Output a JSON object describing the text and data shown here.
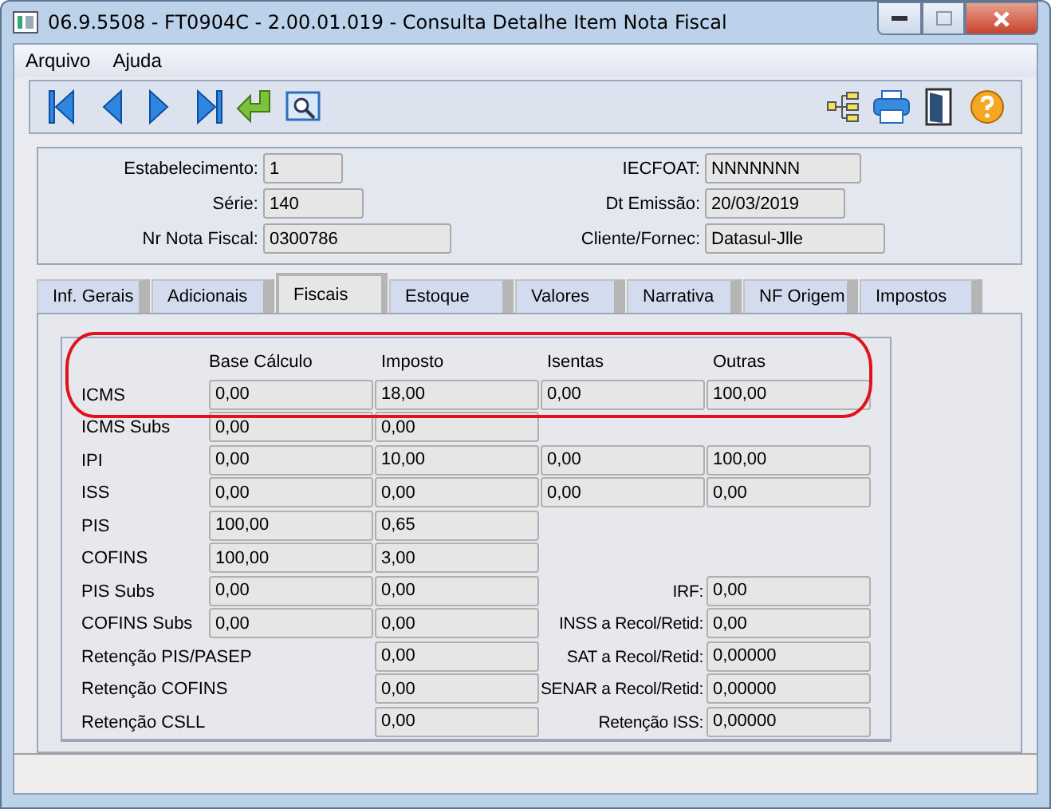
{
  "window": {
    "title": "06.9.5508 - FT0904C - 2.00.01.019 - Consulta Detalhe Item Nota Fiscal"
  },
  "menu": [
    "Arquivo",
    "Ajuda"
  ],
  "header": {
    "left": [
      {
        "label": "Estabelecimento:",
        "value": "1"
      },
      {
        "label": "Série:",
        "value": "140"
      },
      {
        "label": "Nr Nota Fiscal:",
        "value": "0300786"
      }
    ],
    "right": [
      {
        "label": "IECFOAT:",
        "value": "NNNNNNN"
      },
      {
        "label": "Dt Emissão:",
        "value": "20/03/2019"
      },
      {
        "label": "Cliente/Fornec:",
        "value": "Datasul-Jlle"
      }
    ]
  },
  "tabs": [
    {
      "label": "Inf. Gerais",
      "selected": false
    },
    {
      "label": "Adicionais",
      "selected": false
    },
    {
      "label": "Fiscais",
      "selected": true
    },
    {
      "label": "Estoque",
      "selected": false
    },
    {
      "label": "Valores",
      "selected": false
    },
    {
      "label": "Narrativa",
      "selected": false
    },
    {
      "label": "NF Origem",
      "selected": false
    },
    {
      "label": "Impostos",
      "selected": false
    }
  ],
  "fiscais": {
    "columns": [
      "Base Cálculo",
      "Imposto",
      "Isentas",
      "Outras"
    ],
    "highlight_first_row": true,
    "rows": [
      {
        "label": "ICMS",
        "base": "0,00",
        "imposto": "18,00",
        "isentas": "0,00",
        "outras": "100,00"
      },
      {
        "label": "ICMS Subs",
        "base": "0,00",
        "imposto": "0,00"
      },
      {
        "label": "IPI",
        "base": "0,00",
        "imposto": "10,00",
        "isentas": "0,00",
        "outras": "100,00"
      },
      {
        "label": "ISS",
        "base": "0,00",
        "imposto": "0,00",
        "isentas": "0,00",
        "outras": "0,00"
      },
      {
        "label": "PIS",
        "base": "100,00",
        "imposto": "0,65"
      },
      {
        "label": "COFINS",
        "base": "100,00",
        "imposto": "3,00"
      },
      {
        "label": "PIS Subs",
        "base": "0,00",
        "imposto": "0,00",
        "side": {
          "label": "IRF:",
          "value": "0,00"
        }
      },
      {
        "label": "COFINS Subs",
        "base": "0,00",
        "imposto": "0,00",
        "side": {
          "label": "INSS a Recol/Retid:",
          "value": "0,00"
        }
      },
      {
        "label": "Retenção PIS/PASEP",
        "imposto": "0,00",
        "side": {
          "label": "SAT a Recol/Retid:",
          "value": "0,00000"
        }
      },
      {
        "label": "Retenção COFINS",
        "imposto": "0,00",
        "side": {
          "label": "SENAR a Recol/Retid:",
          "value": "0,00000"
        }
      },
      {
        "label": "Retenção CSLL",
        "imposto": "0,00",
        "side": {
          "label": "Retenção ISS:",
          "value": "0,00000"
        }
      }
    ]
  }
}
